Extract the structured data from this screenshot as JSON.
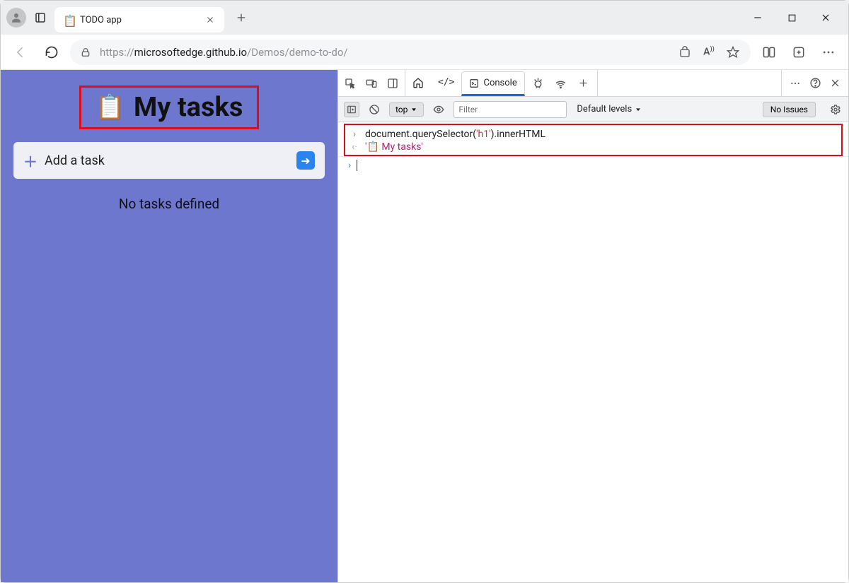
{
  "window": {
    "tab_title": "TODO app",
    "favicon": "📋"
  },
  "addressbar": {
    "url_prefix": "https://",
    "url_host": "microsoftedge.github.io",
    "url_path": "/Demos/demo-to-do/"
  },
  "page": {
    "heading_icon": "📋",
    "heading_text": "My tasks",
    "add_task_placeholder": "Add a task",
    "no_tasks_text": "No tasks defined"
  },
  "devtools": {
    "console_tab_label": "Console",
    "top_selector": "top",
    "filter_placeholder": "Filter",
    "levels_label": "Default levels",
    "issues_label": "No Issues",
    "console_input_pre": "document.querySelector(",
    "console_input_str": "'h1'",
    "console_input_post": ").innerHTML",
    "console_output": "'📋 My tasks'"
  }
}
